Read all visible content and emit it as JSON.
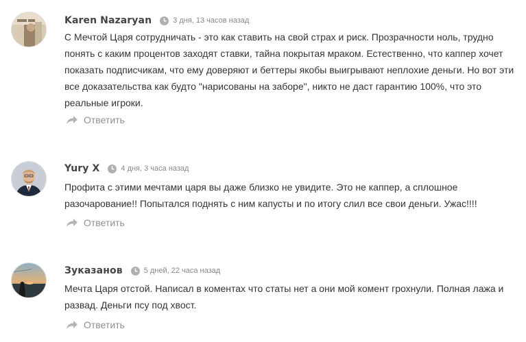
{
  "comments": [
    {
      "author": "Karen Nazaryan",
      "time": "3 дня, 13 часов назад",
      "text": "С Мечтой Царя сотрудничать - это как ставить на свой страх и риск. Прозрачности ноль, трудно понять с каким процентов заходят ставки, тайна покрытая мраком. Естественно, что каппер хочет показать подписчикам, что ему доверяют и беттеры якобы выигрывают неплохие деньги. Но вот эти все доказательства как будто \"нарисованы на заборе\", никто не даст гарантию 100%, что это реальные игроки.",
      "reply_label": "Ответить",
      "avatar_icon": "user-photo-icon"
    },
    {
      "author": "Yury X",
      "time": "4 дня, 3 часа назад",
      "text": "Профита с этими мечтами царя вы даже близко не увидите. Это не каппер, а сплошное разочарование!! Попытался поднять с ним капусты и по итогу слил все свои деньги. Ужас!!!!",
      "reply_label": "Ответить",
      "avatar_icon": "user-photo-icon"
    },
    {
      "author": "Зуказанов",
      "time": "5 дней, 22 часа назад",
      "text": "Мечта Царя отстой. Написал в коментах что статы нет а они мой комент грохнули. Полная лажа и развад. Деньги псу под хвост.",
      "reply_label": "Ответить",
      "avatar_icon": "user-photo-icon"
    }
  ],
  "colors": {
    "author": "#444444",
    "text": "#333333",
    "meta": "#888888",
    "reply": "#8f8f8f"
  }
}
